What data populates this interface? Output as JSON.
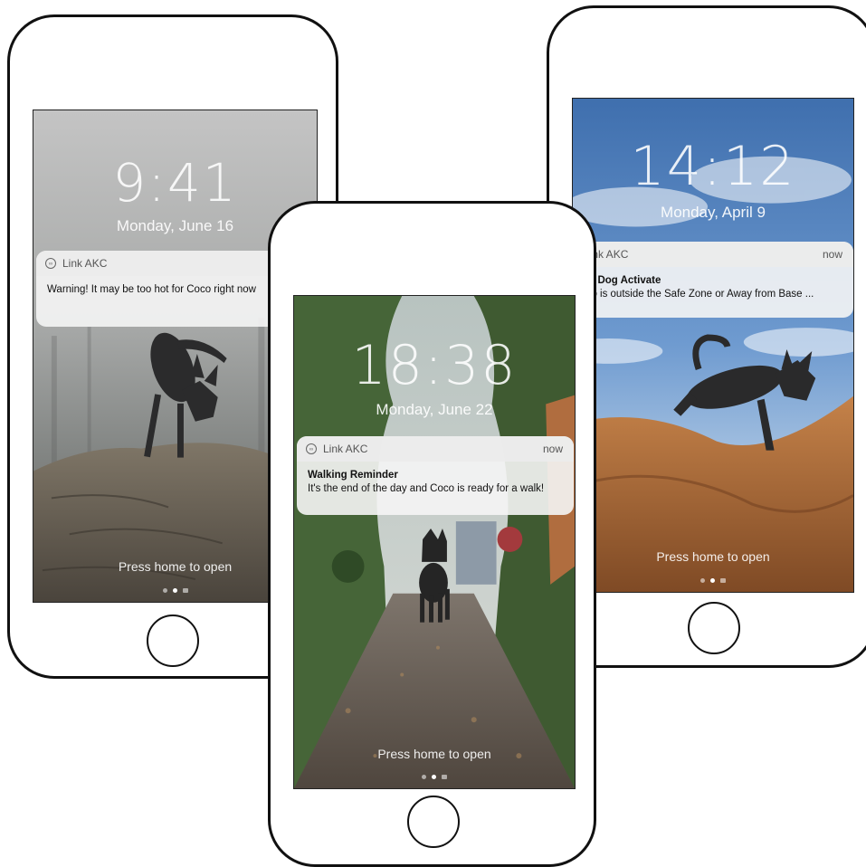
{
  "phones": {
    "left": {
      "time": "9:41",
      "date": "Monday, June 16",
      "notification": {
        "app": "Link AKC",
        "time": "",
        "title": "",
        "message": "Warning! It may be too hot for Coco right now"
      },
      "press_home": "Press home to open"
    },
    "center": {
      "time": "18:38",
      "date": "Monday, June 22",
      "notification": {
        "app": "Link AKC",
        "time": "now",
        "title": "Walking Reminder",
        "message": "It's the end of the day and Coco is ready for a walk!"
      },
      "press_home": "Press home to open"
    },
    "right": {
      "time": "14:12",
      "date": "Monday, April 9",
      "notification": {
        "app": "Link AKC",
        "time": "now",
        "title": "Lost Dog Activate",
        "message": "Coco is outside the Safe Zone or Away from Base ..."
      },
      "press_home": "Press home to open"
    }
  },
  "icons": {
    "app_icon": "link-akc-logo-icon",
    "home_button": "home-button",
    "page_dots": "page-indicator-dots",
    "camera": "camera-icon"
  },
  "colors": {
    "phone_outline": "#111111",
    "notification_bg": "#f5f5f5",
    "sky_blue": "#5d8cc8",
    "dirt_orange": "#b8743e",
    "fog_gray": "#8d908e",
    "foliage_green": "#4b6a3a"
  }
}
